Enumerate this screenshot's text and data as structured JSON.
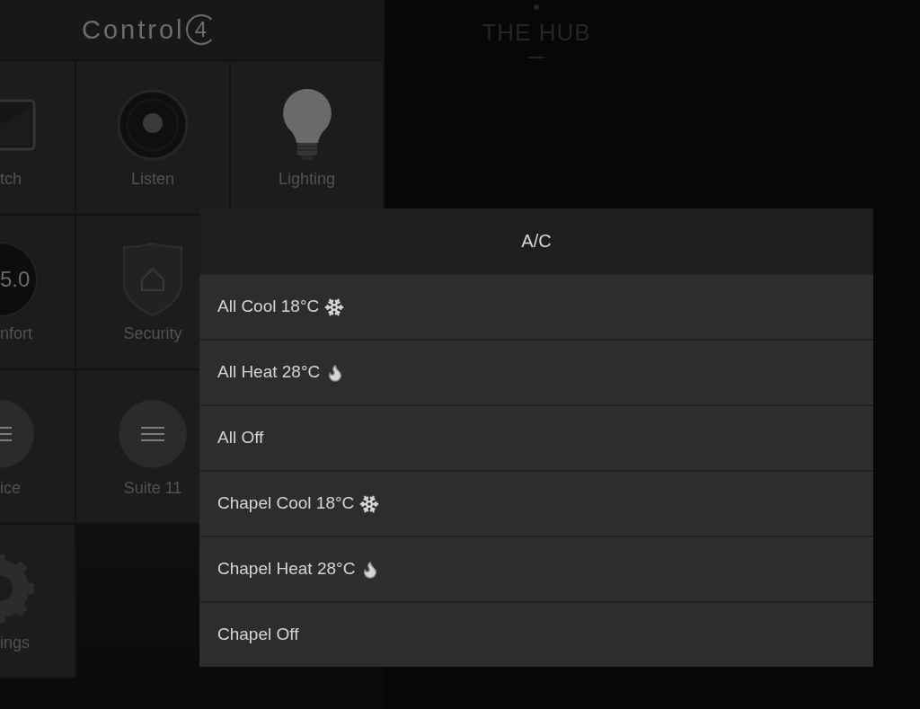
{
  "header": {
    "logo": {
      "word": "Control",
      "badge": "4"
    }
  },
  "tile_rows": [
    [
      {
        "label": "tch",
        "kind": "watch"
      },
      {
        "label": "Listen",
        "kind": "listen"
      },
      {
        "label": "Lighting",
        "kind": "lighting"
      }
    ],
    [
      {
        "label": "nfort",
        "kind": "comfort",
        "reading": "5.0"
      },
      {
        "label": "Security",
        "kind": "security"
      }
    ],
    [
      {
        "label": "ice",
        "kind": "room"
      },
      {
        "label": "Suite 11",
        "kind": "room"
      }
    ],
    [
      {
        "label": "ings",
        "kind": "settings"
      }
    ]
  ],
  "location": {
    "title": "THE HUB"
  },
  "dialog": {
    "title": "A/C",
    "items": [
      {
        "label": "All Cool 18°C",
        "kind": "cool"
      },
      {
        "label": "All Heat 28°C",
        "kind": "heat"
      },
      {
        "label": "All Off",
        "kind": "off"
      },
      {
        "label": "Chapel Cool 18°C",
        "kind": "cool"
      },
      {
        "label": "Chapel Heat 28°C",
        "kind": "heat"
      },
      {
        "label": "Chapel Off",
        "kind": "off"
      }
    ]
  }
}
